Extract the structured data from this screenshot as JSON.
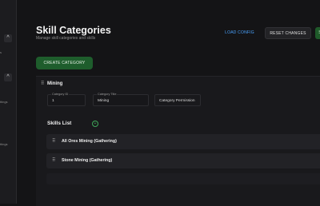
{
  "sidebar": {
    "chevrons": [
      "^",
      "^"
    ],
    "labels": [
      "s",
      "ttings",
      "ttings"
    ]
  },
  "header": {
    "title": "Skill Categories",
    "subtitle": "Manage skill categories and skills",
    "load_config_label": "LOAD CONFIG",
    "reset_changes_label": "RESET CHANGES",
    "save_label": "S"
  },
  "create_category_label": "CREATE CATEGORY",
  "category": {
    "name": "Mining",
    "id_label": "Category ID",
    "id_value": "1",
    "title_label": "Category Title",
    "title_value": "Mining",
    "permission_value": "Category Permission"
  },
  "skills": {
    "title": "Skills List",
    "items": [
      {
        "name": "All Ores Mining (Gathering)"
      },
      {
        "name": "Stone Mining (Gathering)"
      }
    ]
  },
  "colors": {
    "accent_green": "#1e5d2c",
    "link_blue": "#4aa3ff"
  },
  "icons": {
    "drag": "drag-handle-icon",
    "edit": "edit-icon",
    "add": "add-circle-icon"
  }
}
